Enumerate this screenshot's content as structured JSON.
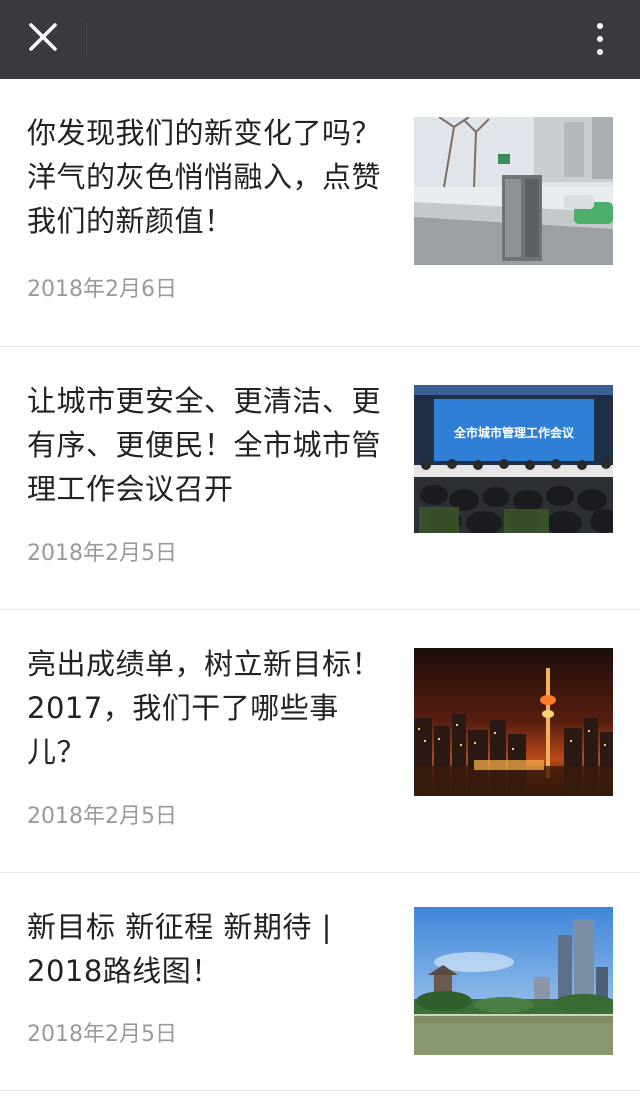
{
  "toolbar": {
    "close_icon": "close-icon",
    "more_icon": "more-vertical-icon"
  },
  "articles": [
    {
      "title": "你发现我们的新变化了吗？洋气的灰色悄悄融入，点赞我们的新颜值！",
      "date": "2018年2月6日",
      "thumbnail": "street-trash-bin-photo"
    },
    {
      "title": "让城市更安全、更清洁、更有序、更便民！全市城市管理工作会议召开",
      "date": "2018年2月5日",
      "thumbnail": "conference-meeting-photo",
      "thumbnail_caption": "全市城市管理工作会议"
    },
    {
      "title": "亮出成绩单，树立新目标！2017，我们干了哪些事儿？",
      "date": "2018年2月5日",
      "thumbnail": "city-night-tower-photo"
    },
    {
      "title": "新目标 新征程 新期待 | 2018路线图！",
      "date": "2018年2月5日",
      "thumbnail": "city-river-skyline-photo"
    }
  ]
}
